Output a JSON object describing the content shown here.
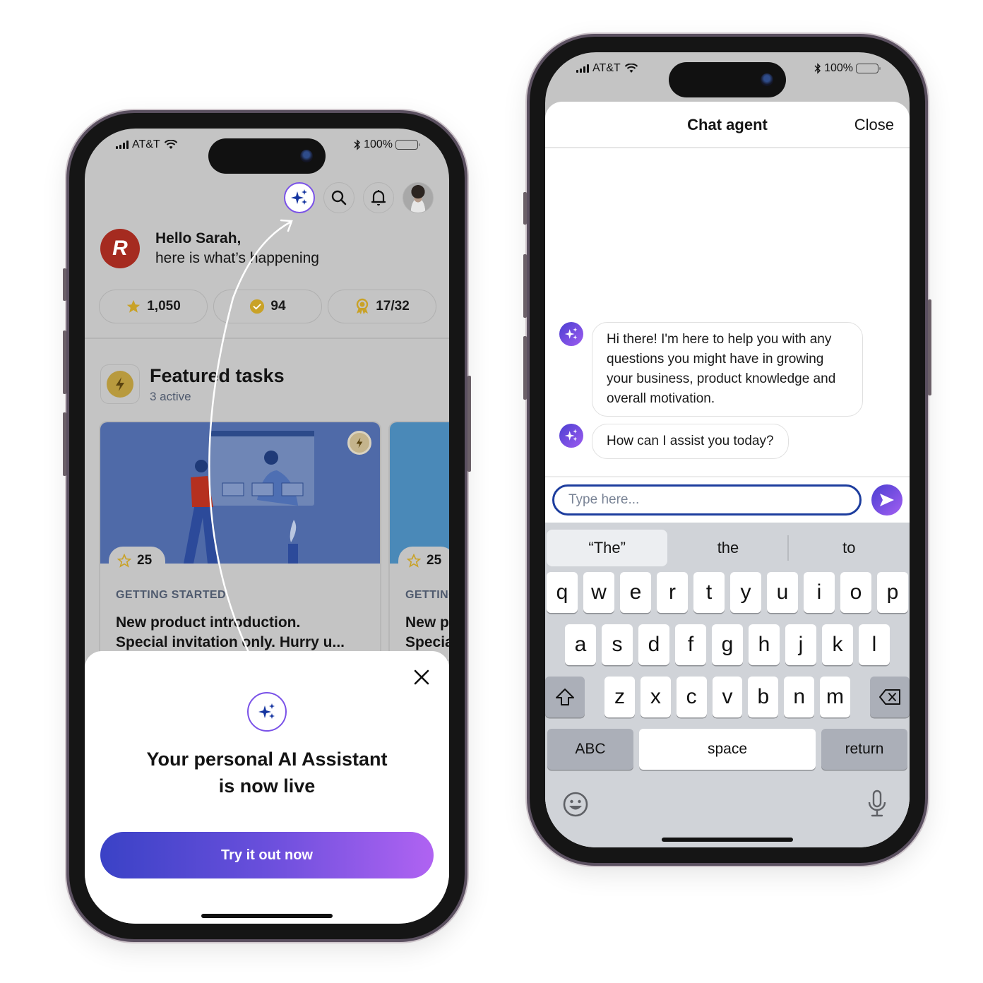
{
  "left_phone": {
    "status_bar": {
      "carrier": "AT&T",
      "battery": "100%"
    },
    "top_icons": [
      "ai-assistant-icon",
      "search-icon",
      "bell-icon",
      "profile-avatar"
    ],
    "greeting": {
      "title": "Hello Sarah,",
      "subtitle": "here is what’s happening",
      "brand_logo_letter": "R"
    },
    "stats": [
      {
        "icon": "star-icon",
        "value": "1,050"
      },
      {
        "icon": "check-badge-icon",
        "value": "94"
      },
      {
        "icon": "award-icon",
        "value": "17/32"
      }
    ],
    "featured": {
      "title": "Featured tasks",
      "subtitle": "3 active"
    },
    "task_cards": [
      {
        "points": "25",
        "category": "GETTING STARTED",
        "title": "New product introduction.",
        "title_line2": "Special invitation only. Hurry u..."
      },
      {
        "points": "25",
        "category": "GETTING STARTED",
        "title": "New product introduction.",
        "title_line2": "Special invitation only. Hurry u..."
      }
    ],
    "sheet": {
      "headline_line1": "Your personal AI Assistant",
      "headline_line2": "is now live",
      "cta_label": "Try it out now"
    }
  },
  "right_phone": {
    "status_bar": {
      "carrier": "AT&T",
      "battery": "100%"
    },
    "header": {
      "title": "Chat agent",
      "close_label": "Close"
    },
    "messages": [
      {
        "sender": "bot",
        "text": "Hi there! I'm here to help you with any questions you might have in growing your business, product knowledge and overall motivation."
      },
      {
        "sender": "bot",
        "text": "How can I assist you today?"
      }
    ],
    "input": {
      "value": "",
      "placeholder": "Type here..."
    },
    "keyboard": {
      "suggestions": [
        "“The”",
        "the",
        "to"
      ],
      "row1": [
        "q",
        "w",
        "e",
        "r",
        "t",
        "y",
        "u",
        "i",
        "o",
        "p"
      ],
      "row2": [
        "a",
        "s",
        "d",
        "f",
        "g",
        "h",
        "j",
        "k",
        "l"
      ],
      "row3": [
        "z",
        "x",
        "c",
        "v",
        "b",
        "n",
        "m"
      ],
      "abc_label": "ABC",
      "space_label": "space",
      "return_label": "return"
    }
  },
  "colors": {
    "accent_purple": "#7a52e8",
    "accent_blue": "#1d3d9e",
    "gradient_start": "#3a42c6",
    "gradient_end": "#b063f2",
    "brand_red": "#a52b20",
    "gold": "#c9a227"
  }
}
